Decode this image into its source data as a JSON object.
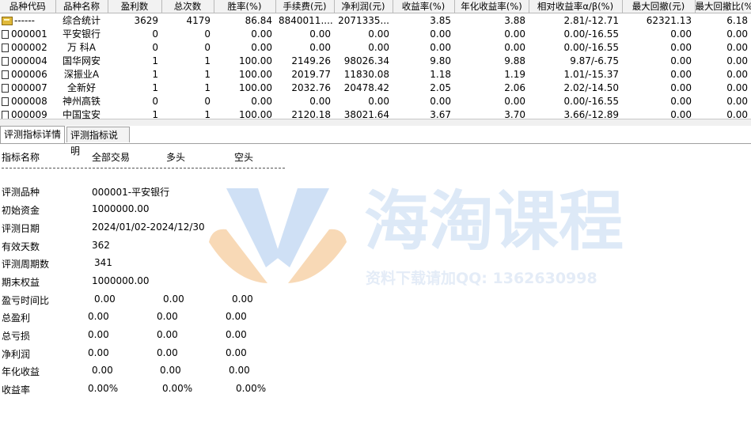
{
  "table": {
    "headers": [
      "品种代码",
      "品种名称",
      "盈利数",
      "总次数",
      "胜率(%)",
      "手续费(元)",
      "净利润(元)",
      "收益率(%)",
      "年化收益率(%)",
      "相对收益率α/β(%)",
      "最大回撤(元)",
      "最大回撤比(%)"
    ],
    "rows": [
      {
        "icon": "folder-icon",
        "cells": [
          "------",
          "综合统计",
          "3629",
          "4179",
          "86.84",
          "8840011....",
          "2071335...",
          "3.85",
          "3.88",
          "2.81/-12.71",
          "62321.13",
          "6.18"
        ]
      },
      {
        "icon": "document-icon",
        "cells": [
          "000001",
          "平安银行",
          "0",
          "0",
          "0.00",
          "0.00",
          "0.00",
          "0.00",
          "0.00",
          "0.00/-16.55",
          "0.00",
          "0.00"
        ]
      },
      {
        "icon": "document-icon",
        "cells": [
          "000002",
          "万 科A",
          "0",
          "0",
          "0.00",
          "0.00",
          "0.00",
          "0.00",
          "0.00",
          "0.00/-16.55",
          "0.00",
          "0.00"
        ]
      },
      {
        "icon": "document-icon",
        "cells": [
          "000004",
          "国华网安",
          "1",
          "1",
          "100.00",
          "2149.26",
          "98026.34",
          "9.80",
          "9.88",
          "9.87/-6.75",
          "0.00",
          "0.00"
        ]
      },
      {
        "icon": "document-icon",
        "cells": [
          "000006",
          "深振业A",
          "1",
          "1",
          "100.00",
          "2019.77",
          "11830.08",
          "1.18",
          "1.19",
          "1.01/-15.37",
          "0.00",
          "0.00"
        ]
      },
      {
        "icon": "document-icon",
        "cells": [
          "000007",
          "全新好",
          "1",
          "1",
          "100.00",
          "2032.76",
          "20478.42",
          "2.05",
          "2.06",
          "2.02/-14.50",
          "0.00",
          "0.00"
        ]
      },
      {
        "icon": "document-icon",
        "cells": [
          "000008",
          "神州高铁",
          "0",
          "0",
          "0.00",
          "0.00",
          "0.00",
          "0.00",
          "0.00",
          "0.00/-16.55",
          "0.00",
          "0.00"
        ]
      },
      {
        "icon": "document-icon",
        "cells": [
          "000009",
          "中国宝安",
          "1",
          "1",
          "100.00",
          "2120.18",
          "38021.64",
          "3.67",
          "3.70",
          "3.66/-12.89",
          "0.00",
          "0.00"
        ]
      }
    ]
  },
  "tabs": [
    "评测指标详情",
    "评测指标说明"
  ],
  "detail": {
    "header": {
      "name": "指标名称",
      "all": "全部交易",
      "long": "多头",
      "short": "空头"
    },
    "info": [
      {
        "label": "评测品种",
        "value": "000001-平安银行"
      },
      {
        "label": "初始资金",
        "value": "1000000.00"
      },
      {
        "label": "评测日期",
        "value": "2024/01/02-2024/12/30"
      },
      {
        "label": "有效天数",
        "value": "362"
      },
      {
        "label": "评测周期数",
        "value": "341"
      },
      {
        "label": "期末权益",
        "value": "1000000.00"
      }
    ],
    "metrics": [
      {
        "label": "盈亏时间比",
        "all": "0.00",
        "long": "0.00",
        "short": "0.00"
      },
      {
        "label": "总盈利",
        "all": "0.00",
        "long": "0.00",
        "short": "0.00"
      },
      {
        "label": "总亏损",
        "all": "0.00",
        "long": "0.00",
        "short": "0.00"
      },
      {
        "label": "净利润",
        "all": "0.00",
        "long": "0.00",
        "short": "0.00"
      },
      {
        "label": "年化收益",
        "all": "0.00",
        "long": "0.00",
        "short": "0.00"
      },
      {
        "label": "收益率",
        "all": "0.00%",
        "long": "0.00%",
        "short": "0.00%"
      }
    ]
  },
  "watermark": {
    "title": "海淘课程",
    "subtitle": "资料下载请加QQ: 1362630998"
  },
  "colors": {
    "header_bg": "#f2f2f2",
    "grid_line": "#b9b9b9",
    "watermark": "#dde9f7",
    "logo_orange": "#f6cfa4",
    "logo_blue": "#cfe0f5"
  }
}
